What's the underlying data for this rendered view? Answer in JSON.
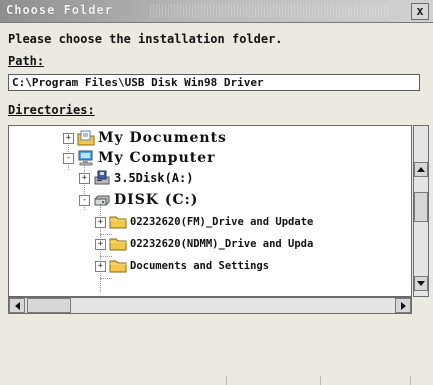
{
  "window": {
    "title": "Choose Folder",
    "close_glyph": "x"
  },
  "prompt": "Please choose the installation folder.",
  "path": {
    "label": "Path:",
    "value": "C:\\Program Files\\USB Disk Win98 Driver"
  },
  "directories": {
    "label": "Directories:",
    "items": [
      {
        "label": "My Documents",
        "icon": "documents-folder-icon",
        "expander": "+"
      },
      {
        "label": "My Computer",
        "icon": "computer-icon",
        "expander": "-"
      },
      {
        "label": "3.5Disk(A:)",
        "icon": "floppy-drive-icon",
        "expander": "+"
      },
      {
        "label": "DISK (C:)",
        "icon": "hard-drive-icon",
        "expander": "-"
      },
      {
        "label": "02232620(FM)_Drive and Update",
        "icon": "folder-icon",
        "expander": "+"
      },
      {
        "label": "02232620(NDMM)_Drive and Upda",
        "icon": "folder-icon",
        "expander": "+"
      },
      {
        "label": "Documents and Settings",
        "icon": "folder-icon",
        "expander": "+"
      }
    ]
  },
  "colors": {
    "folder": "#f2c84b",
    "title_bar": "#a8a8a8"
  }
}
